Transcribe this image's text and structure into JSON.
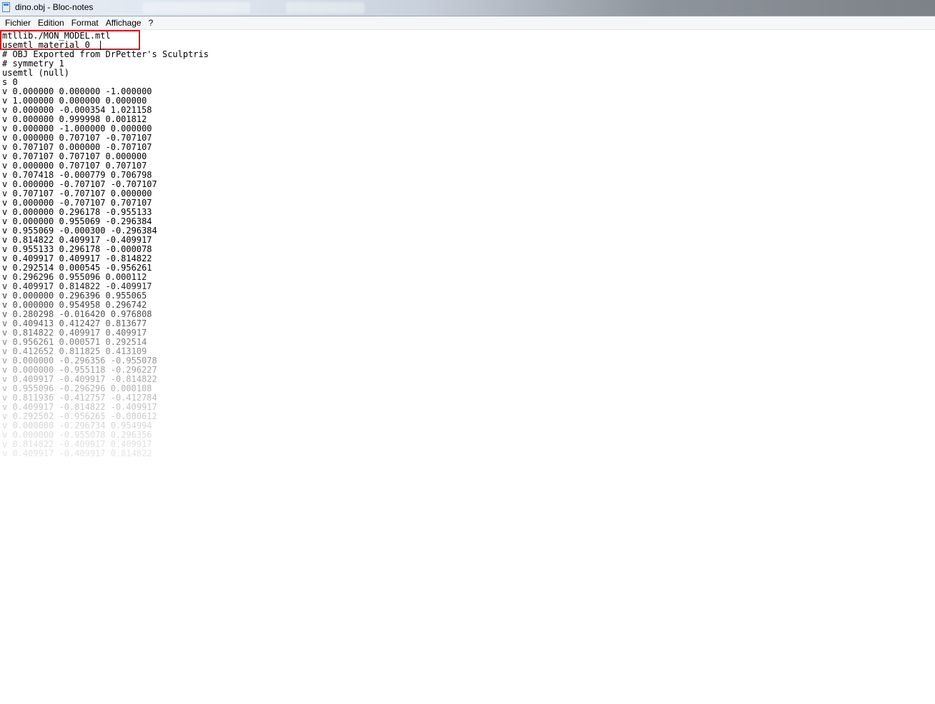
{
  "window": {
    "title": "dino.obj - Bloc-notes",
    "icon": "notepad-icon"
  },
  "menu": {
    "items": [
      "Fichier",
      "Edition",
      "Format",
      "Affichage",
      "?"
    ]
  },
  "highlight_color": "#e0161b",
  "editor": {
    "lines": [
      "mtllib./MON_MODEL.mtl",
      "usemtl material_0",
      "# OBJ Exported from DrPetter's Sculptris",
      "# symmetry 1",
      "usemtl (null)",
      "s 0",
      "v 0.000000 0.000000 -1.000000",
      "v 1.000000 0.000000 0.000000",
      "v 0.000000 -0.000354 1.021158",
      "v 0.000000 0.999998 0.001812",
      "v 0.000000 -1.000000 0.000000",
      "v 0.000000 0.707107 -0.707107",
      "v 0.707107 0.000000 -0.707107",
      "v 0.707107 0.707107 0.000000",
      "v 0.000000 0.707107 0.707107",
      "v 0.707418 -0.000779 0.706798",
      "v 0.000000 -0.707107 -0.707107",
      "v 0.707107 -0.707107 0.000000",
      "v 0.000000 -0.707107 0.707107",
      "v 0.000000 0.296178 -0.955133",
      "v 0.000000 0.955069 -0.296384",
      "v 0.955069 -0.000300 -0.296384",
      "v 0.814822 0.409917 -0.409917",
      "v 0.955133 0.296178 -0.000078",
      "v 0.409917 0.409917 -0.814822",
      "v 0.292514 0.000545 -0.956261",
      "v 0.296296 0.955096 0.000112",
      "v 0.409917 0.814822 -0.409917",
      "v 0.000000 0.296396 0.955065",
      "v 0.000000 0.954958 0.296742",
      "v 0.280298 -0.016420 0.976808",
      "v 0.409413 0.412427 0.813677",
      "v 0.814822 0.409917 0.409917",
      "v 0.956261 0.000571 0.292514",
      "v 0.412652 0.811825 0.413109",
      "v 0.000000 -0.296356 -0.955078",
      "v 0.000000 -0.955118 -0.296227",
      "v 0.409917 -0.409917 -0.814822",
      "v 0.955096 -0.296296 0.000108",
      "v 0.811936 -0.412757 -0.412784",
      "v 0.409917 -0.814822 -0.409917",
      "v 0.292502 -0.956265 -0.000612",
      "v 0.000000 -0.296734 0.954994",
      "v 0.000000 -0.955078 0.296356",
      "v 0.814822 -0.409917 0.409917",
      "v 0.409917 -0.409917 0.814822"
    ]
  }
}
